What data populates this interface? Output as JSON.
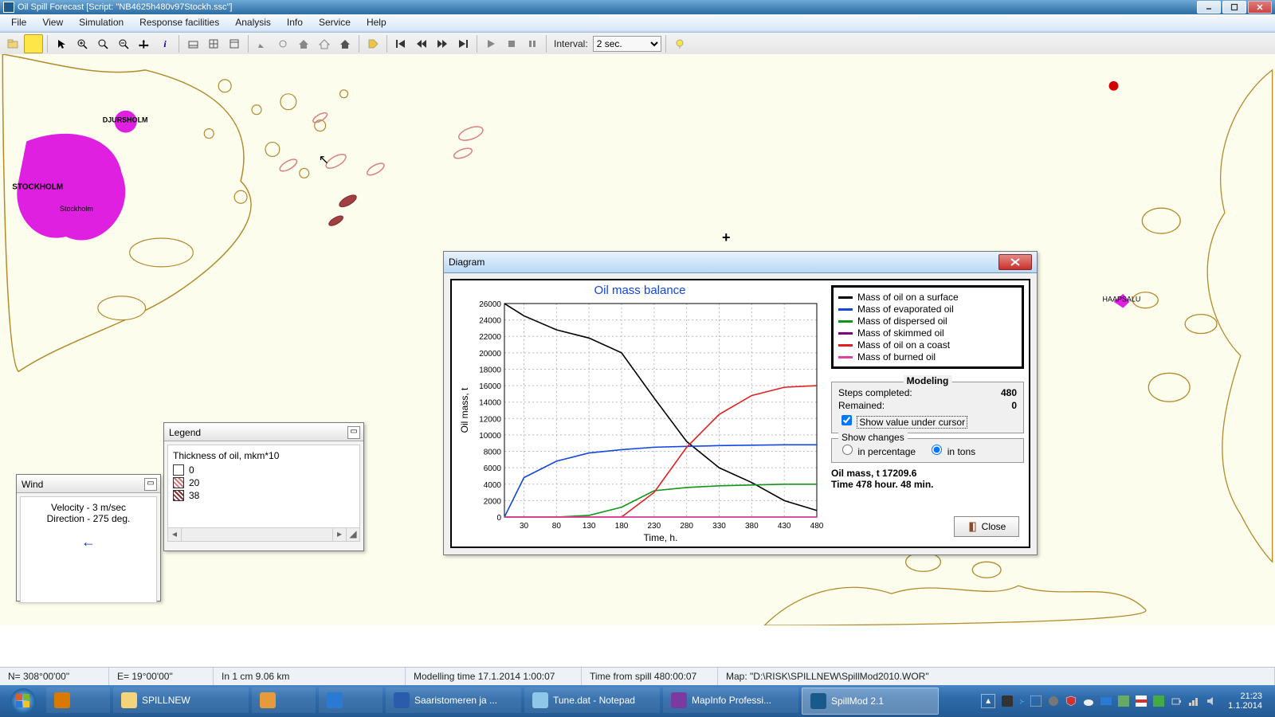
{
  "window": {
    "title": "Oil Spill Forecast [Script: \"NB4625h480v97Stockh.ssc\"]"
  },
  "menus": [
    "File",
    "View",
    "Simulation",
    "Response facilities",
    "Analysis",
    "Info",
    "Service",
    "Help"
  ],
  "toolbar": {
    "interval_label": "Interval:",
    "interval_value": "2 sec."
  },
  "map": {
    "labels": {
      "stockholm": "STOCKHOLM",
      "stockholm2": "Stockholm",
      "djursholm": "DJURSHOLM",
      "haapsalu": "HAAPSALU"
    }
  },
  "wind": {
    "title": "Wind",
    "velocity": "Velocity - 3 m/sec",
    "direction": "Direction - 275 deg."
  },
  "legend": {
    "title": "Legend",
    "heading": "Thickness of oil, mkm*10",
    "items": [
      {
        "value": "0",
        "color": "#ffffff",
        "hatch": false
      },
      {
        "value": "20",
        "color": "#c77",
        "hatch": true
      },
      {
        "value": "38",
        "color": "#8a2f2f",
        "hatch": true
      }
    ]
  },
  "diagram": {
    "title": "Diagram",
    "chart_title": "Oil mass balance",
    "legend": [
      {
        "label": "Mass of oil on a surface",
        "color": "#000000"
      },
      {
        "label": "Mass of evaporated oil",
        "color": "#1446e0"
      },
      {
        "label": "Mass of dispersed oil",
        "color": "#109618"
      },
      {
        "label": "Mass of skimmed oil",
        "color": "#800080"
      },
      {
        "label": "Mass of oil on a coast",
        "color": "#e02020"
      },
      {
        "label": "Mass of burned oil",
        "color": "#e040a0"
      }
    ],
    "modeling": {
      "title": "Modeling",
      "steps_label": "Steps completed:",
      "steps_value": "480",
      "remained_label": "Remained:",
      "remained_value": "0",
      "show_cursor": "Show value under cursor",
      "show_changes_label": "Show changes",
      "opt_percentage": "in percentage",
      "opt_tons": "in tons"
    },
    "status_mass": "Oil mass, t 17209.6",
    "status_time": "Time 478 hour. 48 min.",
    "close": "Close",
    "xlabel": "Time, h.",
    "ylabel": "Oil mass, t"
  },
  "statusbar": {
    "n": "N=  308°00'00\"",
    "e": "E=   19°00'00\"",
    "scale": "In 1 cm     9.06 km",
    "model_time": "Modelling time 17.1.2014 1:00:07",
    "spill_time": "Time from spill 480:00:07",
    "map_path": "Map:  \"D:\\RISK\\SPILLNEW\\SpillMod2010.WOR\""
  },
  "taskbar": {
    "items": [
      {
        "label": "",
        "color": "#d97a00"
      },
      {
        "label": "SPILLNEW",
        "color": "#f3d47a"
      },
      {
        "label": "",
        "color": "#e69b3a"
      },
      {
        "label": "",
        "color": "#2a7ad4"
      },
      {
        "label": "Saaristomeren ja ...",
        "color": "#2a5cab"
      },
      {
        "label": "Tune.dat - Notepad",
        "color": "#8fc7e8"
      },
      {
        "label": "MapInfo Professi...",
        "color": "#7a3aa0"
      },
      {
        "label": "SpillMod 2.1",
        "color": "#1a5a8a"
      }
    ],
    "clock_time": "21:23",
    "clock_date": "1.1.2014"
  },
  "chart_data": {
    "type": "line",
    "title": "Oil mass balance",
    "xlabel": "Time, h.",
    "ylabel": "Oil mass, t",
    "xlim": [
      0,
      480
    ],
    "ylim": [
      0,
      26000
    ],
    "x_ticks": [
      30,
      80,
      130,
      180,
      230,
      280,
      330,
      380,
      430,
      480
    ],
    "y_ticks": [
      0,
      2000,
      4000,
      6000,
      8000,
      10000,
      12000,
      14000,
      16000,
      18000,
      20000,
      22000,
      24000,
      26000
    ],
    "x": [
      0,
      30,
      80,
      130,
      180,
      230,
      280,
      330,
      380,
      430,
      480
    ],
    "series": [
      {
        "name": "Mass of oil on a surface",
        "color": "#000000",
        "values": [
          26000,
          24500,
          22800,
          21800,
          20000,
          14500,
          9200,
          6000,
          4200,
          2000,
          800
        ]
      },
      {
        "name": "Mass of evaporated oil",
        "color": "#1446e0",
        "values": [
          0,
          4800,
          6800,
          7800,
          8200,
          8500,
          8600,
          8700,
          8750,
          8800,
          8800
        ]
      },
      {
        "name": "Mass of dispersed oil",
        "color": "#109618",
        "values": [
          0,
          0,
          0,
          200,
          1200,
          3200,
          3600,
          3800,
          3900,
          4000,
          4000
        ]
      },
      {
        "name": "Mass of skimmed oil",
        "color": "#800080",
        "values": [
          0,
          0,
          0,
          0,
          0,
          0,
          0,
          0,
          0,
          0,
          0
        ]
      },
      {
        "name": "Mass of oil on a coast",
        "color": "#e02020",
        "values": [
          0,
          0,
          0,
          0,
          0,
          3000,
          8500,
          12500,
          14800,
          15800,
          16000
        ]
      },
      {
        "name": "Mass of burned oil",
        "color": "#e040a0",
        "values": [
          0,
          0,
          0,
          0,
          0,
          0,
          0,
          0,
          0,
          0,
          0
        ]
      }
    ]
  }
}
